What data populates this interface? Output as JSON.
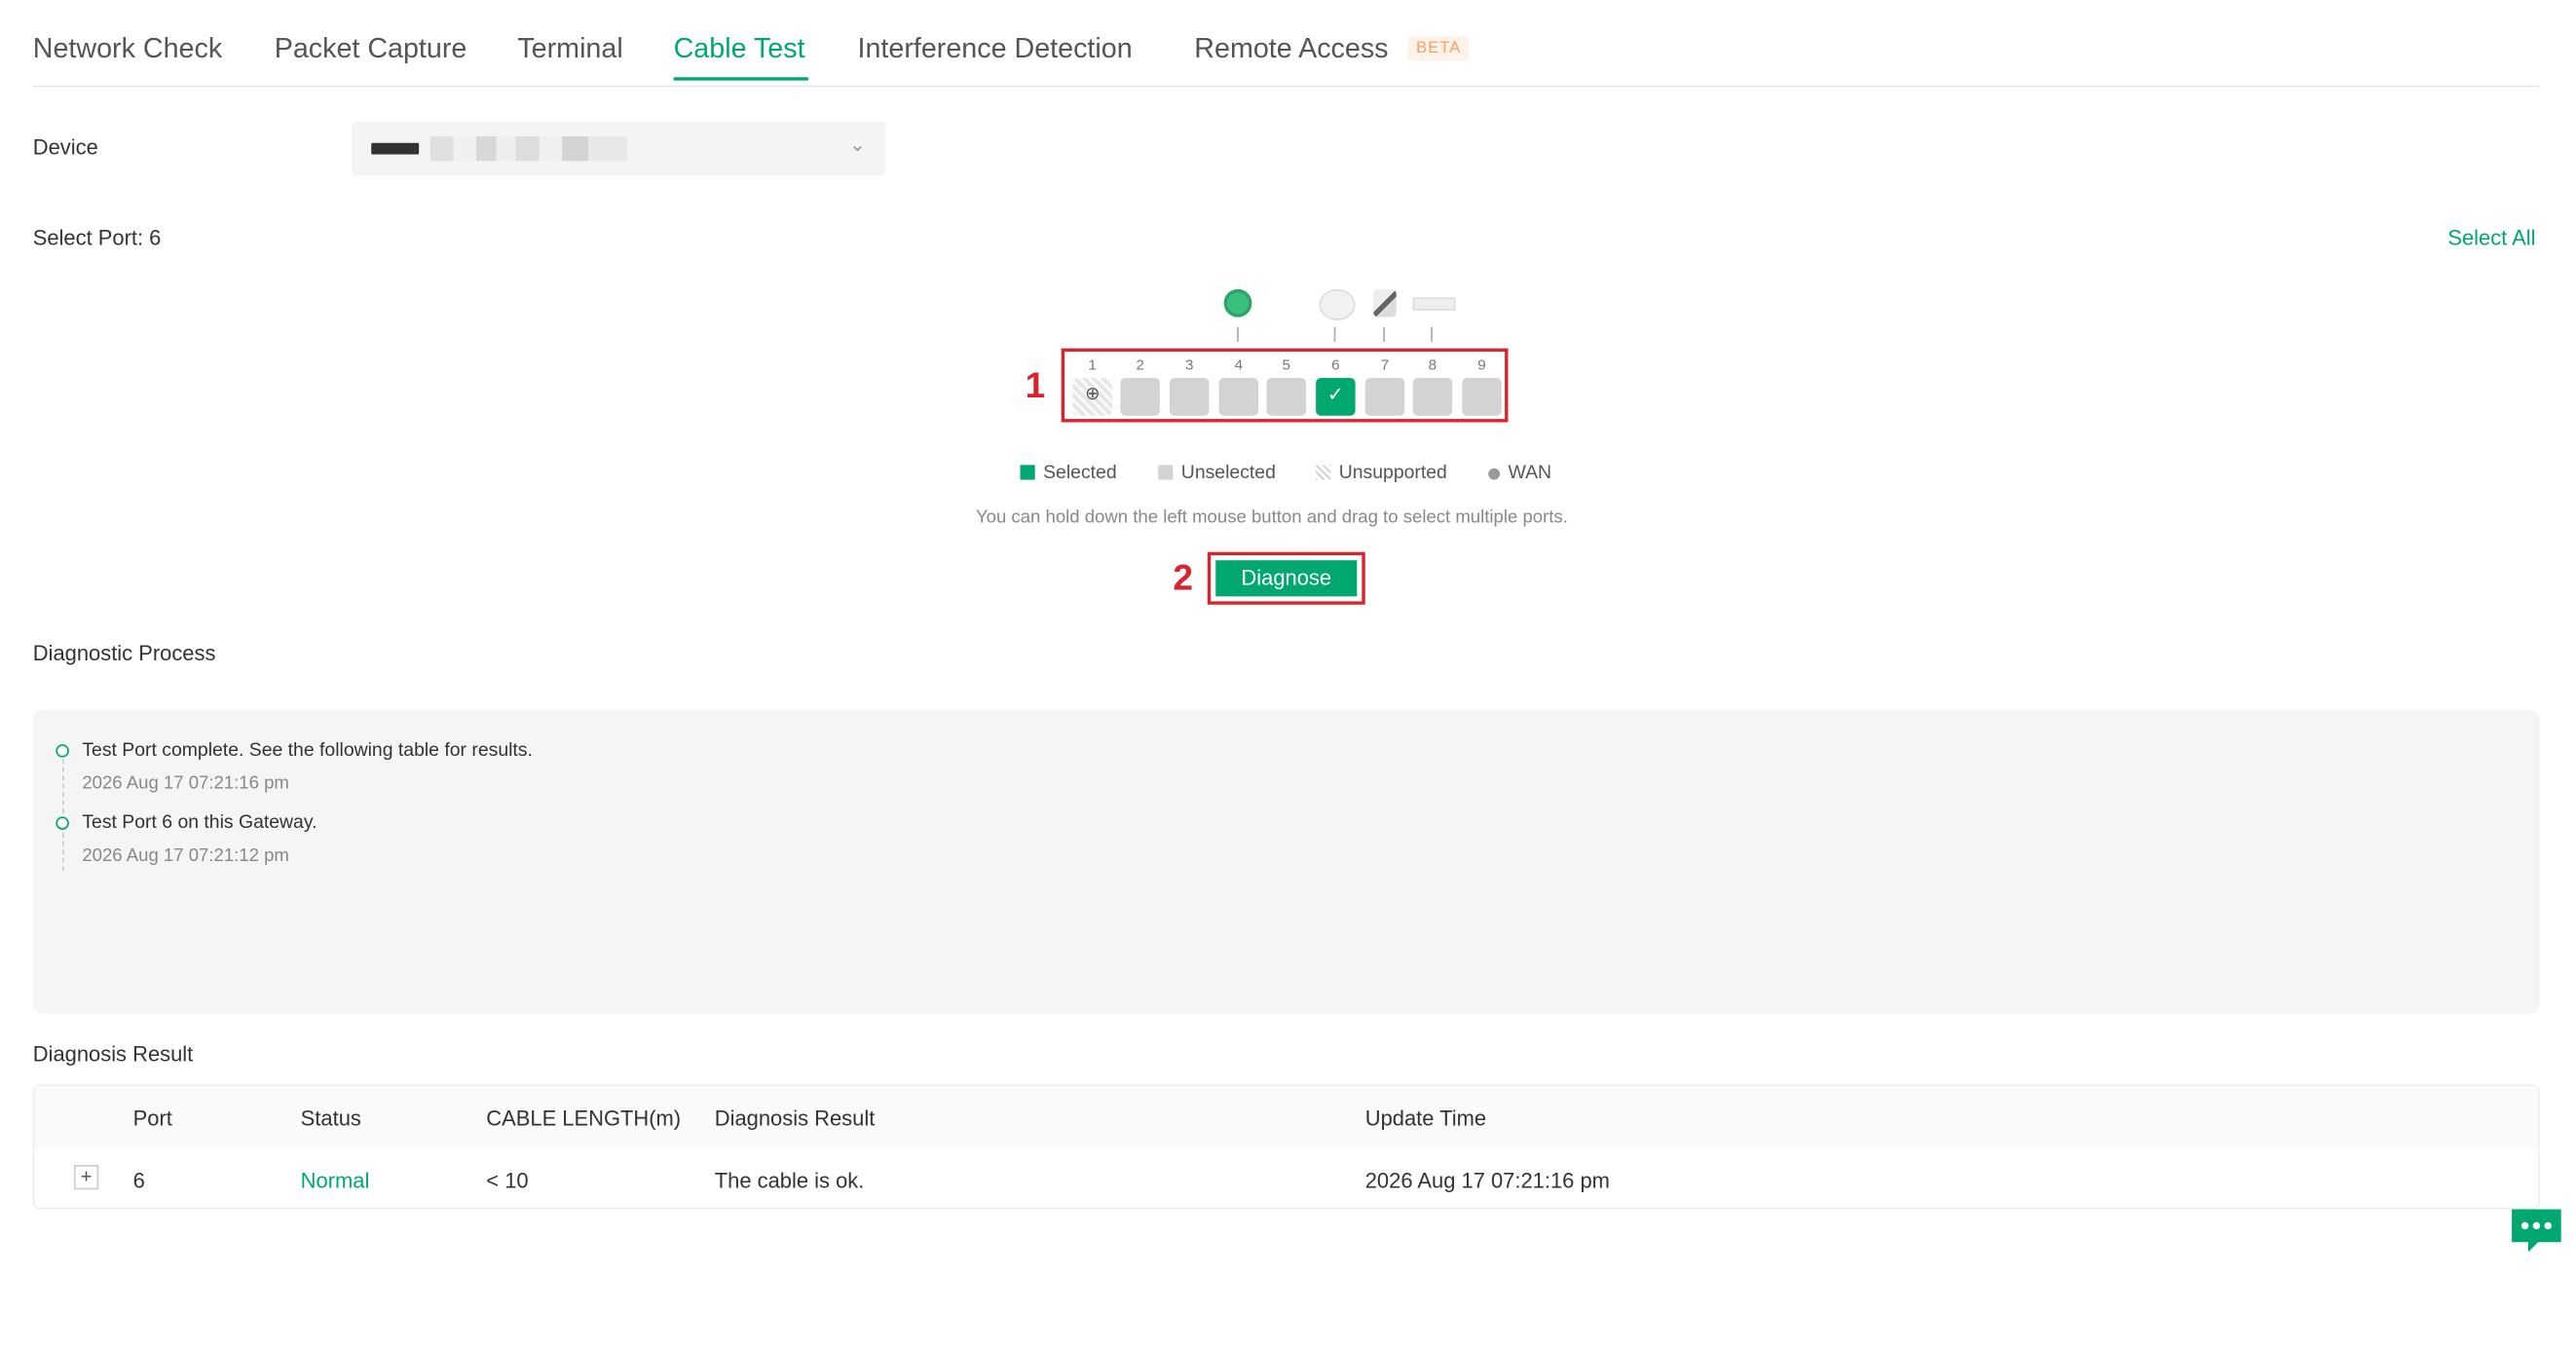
{
  "tabs": [
    {
      "label": "Network Check"
    },
    {
      "label": "Packet Capture"
    },
    {
      "label": "Terminal"
    },
    {
      "label": "Cable Test",
      "active": true
    },
    {
      "label": "Interference Detection"
    },
    {
      "label": "Remote Access",
      "badge": "BETA"
    }
  ],
  "device": {
    "label": "Device"
  },
  "ports": {
    "select_label": "Select Port: 6",
    "select_all": "Select All",
    "numbers": [
      "1",
      "2",
      "3",
      "4",
      "5",
      "6",
      "7",
      "8",
      "9"
    ],
    "selected": "6",
    "unsupported": "1"
  },
  "annotations": {
    "one": "1",
    "two": "2"
  },
  "legend": {
    "selected": "Selected",
    "unselected": "Unselected",
    "unsupported": "Unsupported",
    "wan": "WAN"
  },
  "hint": "You can hold down the left mouse button and drag to select multiple ports.",
  "diagnose_label": "Diagnose",
  "process": {
    "title": "Diagnostic Process",
    "steps": [
      {
        "text": "Test Port complete. See the following table for results.",
        "time": "2026 Aug 17 07:21:16 pm"
      },
      {
        "text": "Test Port 6 on this Gateway.",
        "time": "2026 Aug 17 07:21:12 pm"
      }
    ]
  },
  "result": {
    "title": "Diagnosis Result",
    "headers": {
      "port": "Port",
      "status": "Status",
      "length": "CABLE LENGTH(m)",
      "diagnosis": "Diagnosis Result",
      "time": "Update Time"
    },
    "rows": [
      {
        "port": "6",
        "status": "Normal",
        "length": "< 10",
        "diagnosis": "The cable is ok.",
        "time": "2026 Aug 17 07:21:16 pm"
      }
    ]
  },
  "colors": {
    "accent": "#00a870",
    "highlight": "#d9232d",
    "beta": "#f5a06a"
  }
}
